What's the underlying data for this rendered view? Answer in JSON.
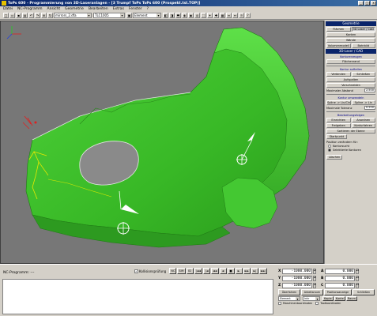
{
  "window": {
    "title": "ToPs 600 - Programmierung von 3D-Laseranlagen - [3 Trumpf ToPs ToPs 600 (Prospekt.tst.TOP)]",
    "min_label": "_",
    "max_label": "□",
    "close_label": "x"
  },
  "menu": [
    "Datei",
    "NC-Programm",
    "Ansicht",
    "Geometrie",
    "Bearbeiten",
    "Extras",
    "Fenster",
    "?"
  ],
  "toolbar": {
    "selects": [
      "mirrors_2.dfa",
      "TLC1005",
      "Element"
    ]
  },
  "right_panel": {
    "header1": "Geometrie",
    "row1": [
      "Flächen",
      "3D Laser / CAD"
    ],
    "row2": [
      "Kanten"
    ],
    "row3": [
      "Wände"
    ],
    "row4": [
      "Volumenmodell",
      "Bohrbild"
    ],
    "header2": "3D-Laser / CAD",
    "label_contour": "Konturerzeugen",
    "btn_surface": "Flächenrand",
    "label_contour_auto": "Kontur aufteilen",
    "row5": [
      "Verbinden",
      "Schließen"
    ],
    "btn_split": "Aufspalten",
    "btn_pre_cut": "Vorschneiden",
    "max_dist_label": "Maximaler Abstand",
    "max_dist_value": "2.500",
    "label_contour_convert": "Kontur umwandeln",
    "row6": [
      "Spline -> Lin/Circ",
      "Spline -> Lin"
    ],
    "max_tol_label": "Maximale Toleranz",
    "max_tol_value": "0.200",
    "label_processing": "Bearbeitungsfolgen",
    "row7": [
      "Einrichten",
      "Anordnen"
    ],
    "row8": [
      "Freigeben",
      "Konturfahren"
    ],
    "btn_sort": "Sortieren der Ebene",
    "btn_start": "Startpunkt",
    "label_position": "Position verändern für:",
    "radio1": "Kontursucht",
    "radio2": "Selektierte Konturen",
    "btn_delete": "Löschen"
  },
  "bottom": {
    "nc_label": "NC-Programm:  ---",
    "checkbox_label": "Kollisionsprüfung",
    "checkbox_checked": "✓",
    "buttons": [
      "NC",
      "SIM",
      "ID",
      "|◄◄",
      "|◄",
      "◄◄",
      "◄",
      "■",
      "►",
      "►►",
      "►|",
      "►►|"
    ],
    "coords": {
      "x_label": "X",
      "x_value": "-1000.000",
      "y_label": "Y",
      "y_value": "-1000.000",
      "z_label": "Z",
      "z_value": "-1000.000",
      "a_label": "A",
      "a_value": "0.000",
      "b_label": "B",
      "b_value": "0.000",
      "c_label": "C",
      "c_value": "0.000"
    },
    "action_buttons": [
      "Überfahren",
      "Arbeitsraum",
      "Positionsanzeige",
      "Schließen"
    ],
    "speed_selects": [
      "Element",
      "Inkr",
      "Rotation",
      "Aktuell"
    ],
    "slider_labels": [
      "1",
      "10",
      "100"
    ],
    "bottom_checkboxes": [
      "Maschinenkoordinaten",
      "Toolkoordinaten"
    ],
    "link_btns": [
      "Kopie",
      "Kante",
      "Raum"
    ]
  },
  "colors": {
    "part_green": "#3dbf2a",
    "viewport_bg": "#787878",
    "title_blue": "#0a246a"
  }
}
